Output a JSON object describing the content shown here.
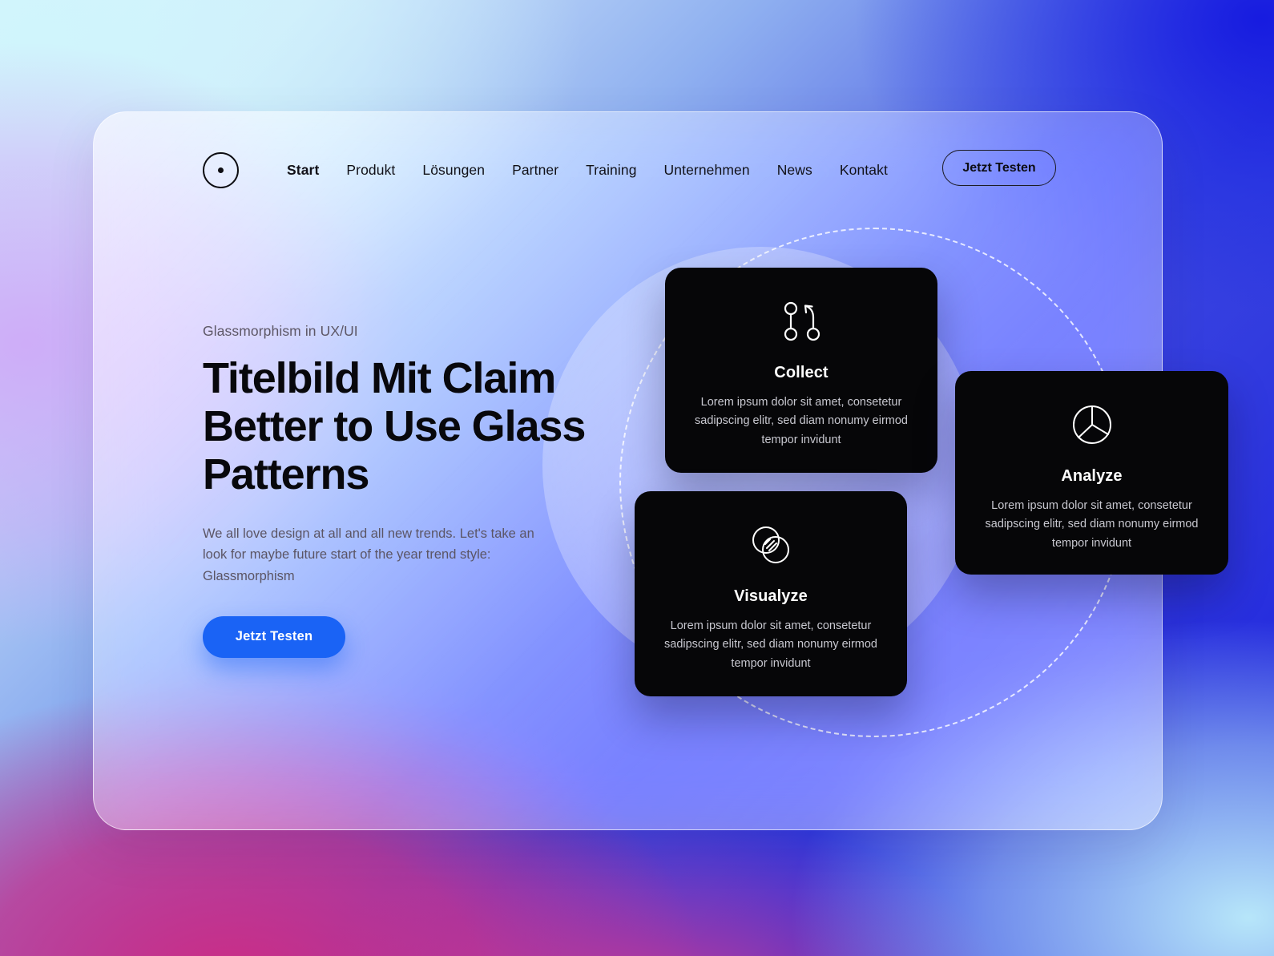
{
  "nav": {
    "logo_icon": "circle-dot-logo-icon",
    "links": [
      {
        "label": "Start",
        "active": true
      },
      {
        "label": "Produkt",
        "active": false
      },
      {
        "label": "Lösungen",
        "active": false
      },
      {
        "label": "Partner",
        "active": false
      },
      {
        "label": "Training",
        "active": false
      },
      {
        "label": "Unternehmen",
        "active": false
      },
      {
        "label": "News",
        "active": false
      },
      {
        "label": "Kontakt",
        "active": false
      }
    ],
    "cta_label": "Jetzt Testen"
  },
  "hero": {
    "eyebrow": "Glassmorphism in UX/UI",
    "title": "Titelbild Mit Claim Better to Use Glass Patterns",
    "body": "We all love design at all and all new trends. Let's take an look for maybe future start of the year trend style: Glassmorphism",
    "cta_label": "Jetzt Testen"
  },
  "cards": [
    {
      "id": "collect",
      "title": "Collect",
      "desc": "Lorem ipsum dolor sit amet, consetetur sadipscing elitr, sed diam nonumy eirmod tempor invidunt",
      "icon": "git-branch-icon"
    },
    {
      "id": "visualyze",
      "title": "Visualyze",
      "desc": "Lorem ipsum dolor sit amet, consetetur sadipscing elitr, sed diam nonumy eirmod tempor invidunt",
      "icon": "venn-diagram-icon"
    },
    {
      "id": "analyze",
      "title": "Analyze",
      "desc": "Lorem ipsum dolor sit amet, consetetur sadipscing elitr, sed diam nonumy eirmod tempor invidunt",
      "icon": "pie-chart-icon"
    }
  ],
  "colors": {
    "primary_blue": "#1a63f5",
    "card_black": "#060608",
    "background_cyan": "#d9f4fb",
    "background_lavender": "#ceaaf8",
    "background_magenta": "#ce2c84",
    "background_blue": "#1a1fdd",
    "text_dark": "#08080c",
    "text_muted": "#5b5564"
  }
}
